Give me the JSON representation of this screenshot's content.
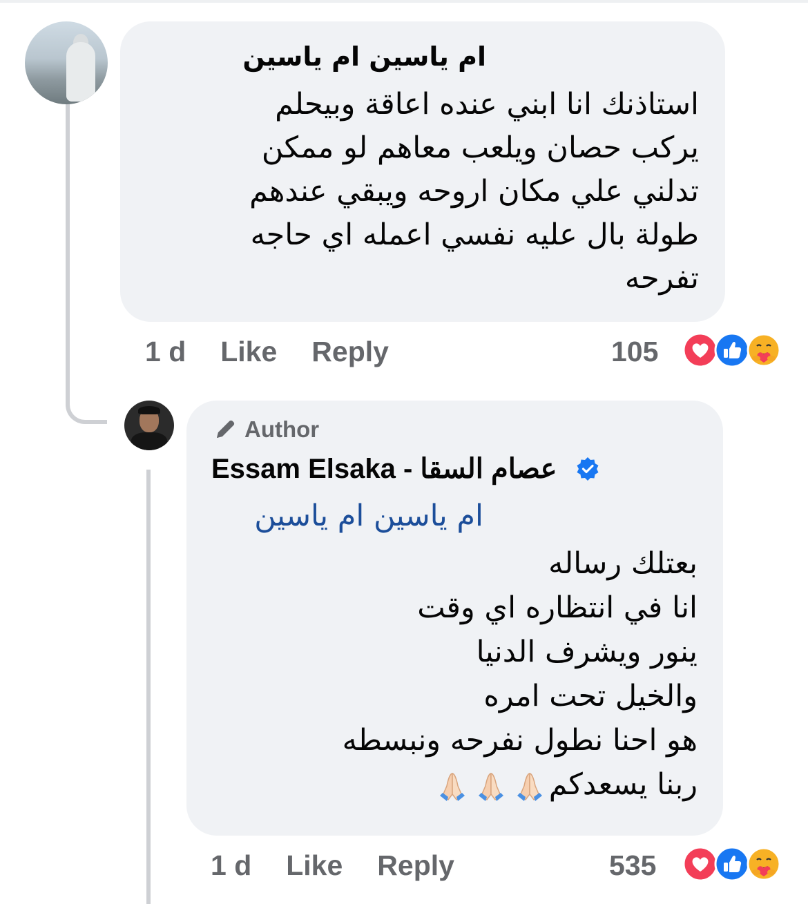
{
  "comment": {
    "author_name": "ام ياسين ام ياسين",
    "text_lines": [
      "استاذنك انا ابني عنده اعاقة وبيحلم",
      "يركب حصان ويلعب معاهم لو ممكن",
      "تدلني علي مكان اروحه ويبقي عندهم",
      "طولة بال عليه نفسي اعمله اي حاجه",
      "تفرحه"
    ],
    "time": "1 d",
    "like_label": "Like",
    "reply_label": "Reply",
    "reaction_count": "105",
    "reactions": [
      "love-icon",
      "like-icon",
      "care-icon"
    ]
  },
  "reply": {
    "badge_label": "Author",
    "badge_icon": "pencil-icon",
    "author_name": "Essam Elsaka - عصام  السقا",
    "verified_icon": "verified-badge-icon",
    "mention": "ام ياسين ام ياسين",
    "text_lines": [
      "بعتلك رساله",
      "انا في انتظاره اي وقت",
      "ينور ويشرف الدنيا",
      " والخيل تحت امره",
      "هو احنا نطول نفرحه ونبسطه",
      "ربنا يسعدكم"
    ],
    "emoji_icons": [
      "folded-hands-icon",
      "folded-hands-icon",
      "folded-hands-icon"
    ],
    "time": "1 d",
    "like_label": "Like",
    "reply_label": "Reply",
    "reaction_count": "535",
    "reactions": [
      "love-icon",
      "like-icon",
      "care-icon"
    ]
  },
  "colors": {
    "bubble": "#f0f2f5",
    "meta_text": "#65676b",
    "mention": "#1c4e9a",
    "love": "#f33e58",
    "like": "#1877f2",
    "care": "#f7b125",
    "thread_line": "#ced0d4"
  }
}
